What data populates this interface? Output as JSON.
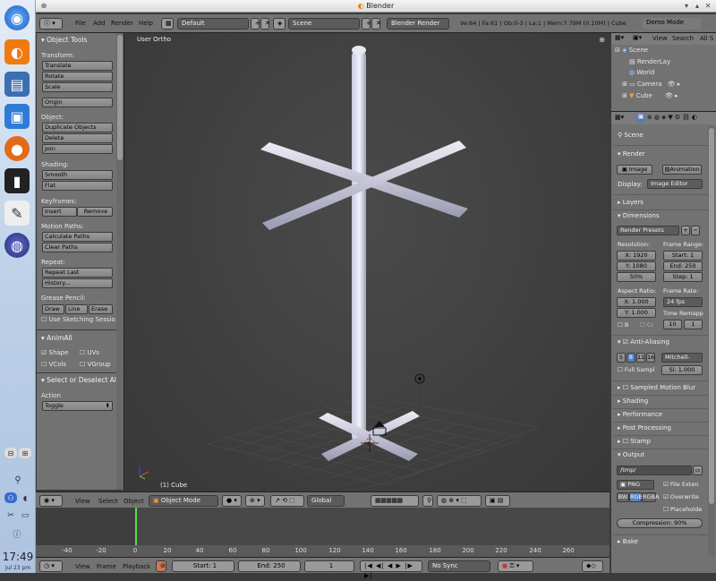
{
  "window": {
    "title": "Blender"
  },
  "clock": {
    "time": "17:49",
    "date": "Jul 23 pm"
  },
  "infobar": {
    "menus": [
      "File",
      "Add",
      "Render",
      "Help"
    ],
    "layout": "Default",
    "scene": "Scene",
    "engine": "Blender Render",
    "stats": "Ve:64 | Fa:61 | Ob:0-3 | La:1 | Mem:7.79M (0.10M) | Cube",
    "demo": "Demo Mode"
  },
  "toolshelf": {
    "panel_title": "Object Tools",
    "transform_label": "Transform:",
    "translate": "Translate",
    "rotate": "Rotate",
    "scale": "Scale",
    "origin": "Origin",
    "object_label": "Object:",
    "duplicate": "Duplicate Objects",
    "delete": "Delete",
    "join": "Join",
    "shading_label": "Shading:",
    "smooth": "Smooth",
    "flat": "Flat",
    "keyframes_label": "Keyframes:",
    "insert": "Insert",
    "remove": "Remove",
    "motion_label": "Motion Paths:",
    "calc_paths": "Calculate Paths",
    "clear_paths": "Clear Paths",
    "repeat_label": "Repeat:",
    "repeat_last": "Repeat Last",
    "history": "History...",
    "grease_label": "Grease Pencil:",
    "draw": "Draw",
    "line": "Line",
    "erase": "Erase",
    "sketch": "Use Sketching Sessio",
    "animall_title": "AnimAll",
    "shape": "Shape",
    "uvs": "UVs",
    "vcols": "VCols",
    "vgroup": "VGroup",
    "select_title": "Select or Deselect All",
    "action_label": "Action",
    "action_value": "Toggle"
  },
  "viewport": {
    "view_label": "User Ortho",
    "object_label": "(1) Cube"
  },
  "outliner": {
    "view": "View",
    "search": "Search",
    "all": "All S",
    "items": [
      "Scene",
      "RenderLay",
      "World",
      "Camera",
      "Cube"
    ]
  },
  "properties": {
    "scene_label": "Scene",
    "render_title": "Render",
    "image_btn": "Image",
    "animation_btn": "Animation",
    "display_label": "Display:",
    "display_value": "Image Editor",
    "layers_title": "Layers",
    "dimensions_title": "Dimensions",
    "render_presets": "Render Presets",
    "resolution_label": "Resolution:",
    "res_x": "X: 1920",
    "res_y": "Y: 1080",
    "res_pct": "50%",
    "frame_range_label": "Frame Range:",
    "start": "Start: 1",
    "end": "End: 250",
    "step": "Step: 1",
    "aspect_label": "Aspect Ratio:",
    "aspect_x": "X: 1.000",
    "aspect_y": "Y: 1.000",
    "frame_rate_label": "Frame Rate:",
    "fps": "24 fps",
    "remap_label": "Time Remapp",
    "b_label": "B",
    "cr_label": "Cr",
    "remap_old": "10",
    "remap_new": "1",
    "aa_title": "Anti-Aliasing",
    "aa_samples": [
      "5",
      "8",
      "11",
      "16"
    ],
    "filter": "Mitchell-",
    "full_sample": "Full Sampl",
    "filter_size": "Si: 1.000",
    "mblur_title": "Sampled Motion Blur",
    "shading_title": "Shading",
    "performance_title": "Performance",
    "post_title": "Post Processing",
    "stamp_title": "Stamp",
    "output_title": "Output",
    "output_path": "/tmp/",
    "format": "PNG",
    "file_ext": "File Exten",
    "overwrite": "Overwrite",
    "placeholder": "Placeholde",
    "color_modes": [
      "BW",
      "RGB",
      "RGBA"
    ],
    "compression": "Compression: 90%",
    "bake_title": "Bake"
  },
  "view_header": {
    "menus": [
      "View",
      "Select",
      "Object"
    ],
    "mode": "Object Mode",
    "orientation": "Global"
  },
  "timeline": {
    "ticks": [
      "-40",
      "-20",
      "0",
      "20",
      "40",
      "60",
      "80",
      "100",
      "120",
      "140",
      "160",
      "180",
      "200",
      "220",
      "240",
      "260"
    ],
    "current_frame": 1,
    "menus": [
      "View",
      "Frame",
      "Playback"
    ],
    "start": "Start: 1",
    "end": "End: 250",
    "frame": "1",
    "sync": "No Sync"
  }
}
